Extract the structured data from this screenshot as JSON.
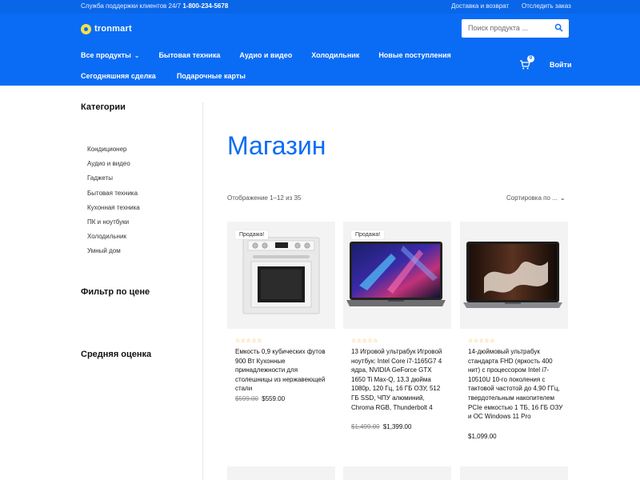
{
  "header": {
    "support_label": "Служба поддержки клиентов 24/7",
    "support_phone": "1-800-234-5678",
    "top_links": [
      "Доставка и возврат",
      "Отследить заказ"
    ],
    "logo_text": "tronmart",
    "search_placeholder": "Поиск продукта ...",
    "nav_row1": [
      "Все продукты",
      "Бытовая техника",
      "Аудио и видео",
      "Холодильник",
      "Новые поступления"
    ],
    "nav_row2": [
      "Сегодняшняя сделка",
      "Подарочные карты"
    ],
    "cart_count": "0",
    "login_label": "Войти",
    "accent_color": "#0a6cf5"
  },
  "sidebar": {
    "categories_title": "Категории",
    "categories": [
      "Кондиционер",
      "Аудио и видео",
      "Гаджеты",
      "Бытовая техника",
      "Кухонная техника",
      "ПК и ноутбуки",
      "Холодильник",
      "Умный дом"
    ],
    "price_filter_title": "Фильтр по цене",
    "rating_title": "Средняя оценка"
  },
  "main": {
    "title": "Магазин",
    "result_count": "Отображение 1–12 из 35",
    "sort_label": "Сортировка по ...",
    "products": [
      {
        "sale_badge": "Продажа!",
        "stars": "☆☆☆☆☆",
        "title": "Емкость 0,9 кубических футов 900 Вт Кухонные принадлежности для столешницы из нержавеющей стали",
        "old_price": "$599.00",
        "price": "$559.00"
      },
      {
        "sale_badge": "Продажа!",
        "stars": "☆☆☆☆☆",
        "title": "13 Игровой ультрабук Игровой ноутбук: Intel Core i7-1165G7 4 ядра, NVIDIA GeForce GTX 1650 Ti Max-Q, 13,3 дюйма 1080p, 120 Гц, 16 ГБ ОЗУ, 512 ГБ SSD, ЧПУ алюминий, Chroma RGB, Thunderbolt 4",
        "old_price": "$1,499.00",
        "price": "$1,399.00"
      },
      {
        "stars": "☆☆☆☆☆",
        "title": "14-дюймовый ультрабук стандарта FHD (яркость 400 нит) с процессором Intel i7-10510U 10-го поколения с тактовой частотой до 4,90 ГГц, твердотельным накопителем PCIe емкостью 1 ТБ, 16 ГБ ОЗУ и ОС Windows 11 Pro",
        "price": "$1,099.00"
      }
    ]
  }
}
